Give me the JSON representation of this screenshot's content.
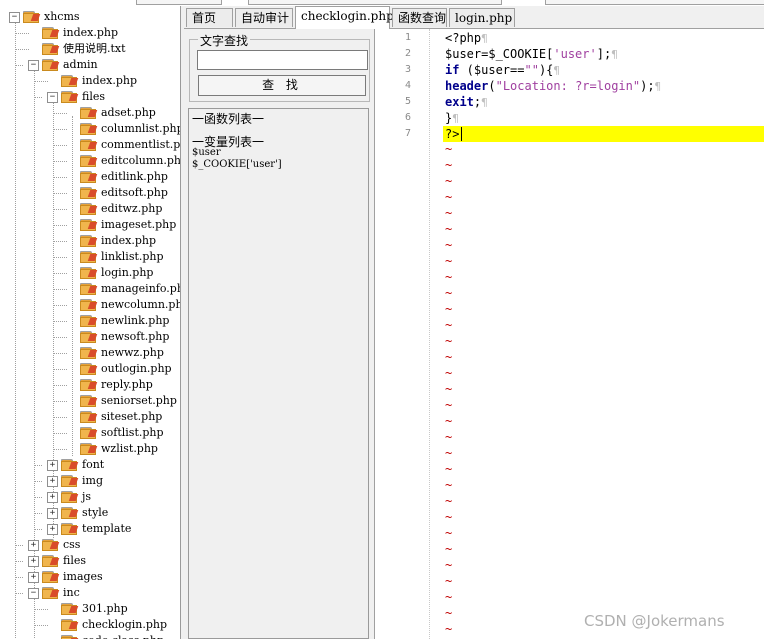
{
  "tree": {
    "items": [
      {
        "label": "xhcms",
        "depth": 0,
        "toggle": "−"
      },
      {
        "label": "index.php",
        "depth": 1
      },
      {
        "label": "使用说明.txt",
        "depth": 1
      },
      {
        "label": "admin",
        "depth": 1,
        "toggle": "−"
      },
      {
        "label": "index.php",
        "depth": 2
      },
      {
        "label": "files",
        "depth": 2,
        "toggle": "−"
      },
      {
        "label": "adset.php",
        "depth": 3
      },
      {
        "label": "columnlist.php",
        "depth": 3
      },
      {
        "label": "commentlist.php",
        "depth": 3
      },
      {
        "label": "editcolumn.php",
        "depth": 3
      },
      {
        "label": "editlink.php",
        "depth": 3
      },
      {
        "label": "editsoft.php",
        "depth": 3
      },
      {
        "label": "editwz.php",
        "depth": 3
      },
      {
        "label": "imageset.php",
        "depth": 3
      },
      {
        "label": "index.php",
        "depth": 3
      },
      {
        "label": "linklist.php",
        "depth": 3
      },
      {
        "label": "login.php",
        "depth": 3
      },
      {
        "label": "manageinfo.php",
        "depth": 3
      },
      {
        "label": "newcolumn.php",
        "depth": 3
      },
      {
        "label": "newlink.php",
        "depth": 3
      },
      {
        "label": "newsoft.php",
        "depth": 3
      },
      {
        "label": "newwz.php",
        "depth": 3
      },
      {
        "label": "outlogin.php",
        "depth": 3
      },
      {
        "label": "reply.php",
        "depth": 3
      },
      {
        "label": "seniorset.php",
        "depth": 3
      },
      {
        "label": "siteset.php",
        "depth": 3
      },
      {
        "label": "softlist.php",
        "depth": 3
      },
      {
        "label": "wzlist.php",
        "depth": 3
      },
      {
        "label": "font",
        "depth": 2,
        "toggle": "+"
      },
      {
        "label": "img",
        "depth": 2,
        "toggle": "+"
      },
      {
        "label": "js",
        "depth": 2,
        "toggle": "+"
      },
      {
        "label": "style",
        "depth": 2,
        "toggle": "+"
      },
      {
        "label": "template",
        "depth": 2,
        "toggle": "+"
      },
      {
        "label": "css",
        "depth": 1,
        "toggle": "+"
      },
      {
        "label": "files",
        "depth": 1,
        "toggle": "+"
      },
      {
        "label": "images",
        "depth": 1,
        "toggle": "+"
      },
      {
        "label": "inc",
        "depth": 1,
        "toggle": "−"
      },
      {
        "label": "301.php",
        "depth": 2
      },
      {
        "label": "checklogin.php",
        "depth": 2
      },
      {
        "label": "code.class.php",
        "depth": 2
      }
    ]
  },
  "tabs": [
    {
      "label": "首页"
    },
    {
      "label": "自动审计"
    },
    {
      "label": "checklogin.php",
      "active": true
    },
    {
      "label": "函数查询"
    },
    {
      "label": "login.php"
    }
  ],
  "search": {
    "group_title": "文字查找",
    "input_value": "",
    "button_label": "查 找"
  },
  "functions": {
    "func_title": "一函数列表一",
    "var_title": "一变量列表一",
    "variables": [
      "$user",
      "$_COOKIE['user']"
    ]
  },
  "editor": {
    "line_numbers": [
      "1",
      "2",
      "3",
      "4",
      "5",
      "6",
      "7"
    ],
    "lines": [
      [
        {
          "t": "<?php",
          "c": ""
        }
      ],
      [
        {
          "t": "$user=$_COOKIE[",
          "c": ""
        },
        {
          "t": "'user'",
          "c": "str"
        },
        {
          "t": "];",
          "c": ""
        }
      ],
      [
        {
          "t": "if",
          "c": "kw"
        },
        {
          "t": " ($user==",
          "c": ""
        },
        {
          "t": "\"\"",
          "c": "str"
        },
        {
          "t": "){",
          "c": ""
        }
      ],
      [
        {
          "t": "header",
          "c": "kw"
        },
        {
          "t": "(",
          "c": ""
        },
        {
          "t": "\"Location: ?r=login\"",
          "c": "str"
        },
        {
          "t": ");",
          "c": ""
        }
      ],
      [
        {
          "t": "exit",
          "c": "kw"
        },
        {
          "t": ";",
          "c": ""
        }
      ],
      [
        {
          "t": "}",
          "c": ""
        }
      ],
      [
        {
          "t": "?>",
          "c": ""
        }
      ]
    ],
    "eol_marker": "¶",
    "tilde": "~",
    "highlight_color": "#ffff00"
  },
  "watermark": "CSDN @Jokermans"
}
